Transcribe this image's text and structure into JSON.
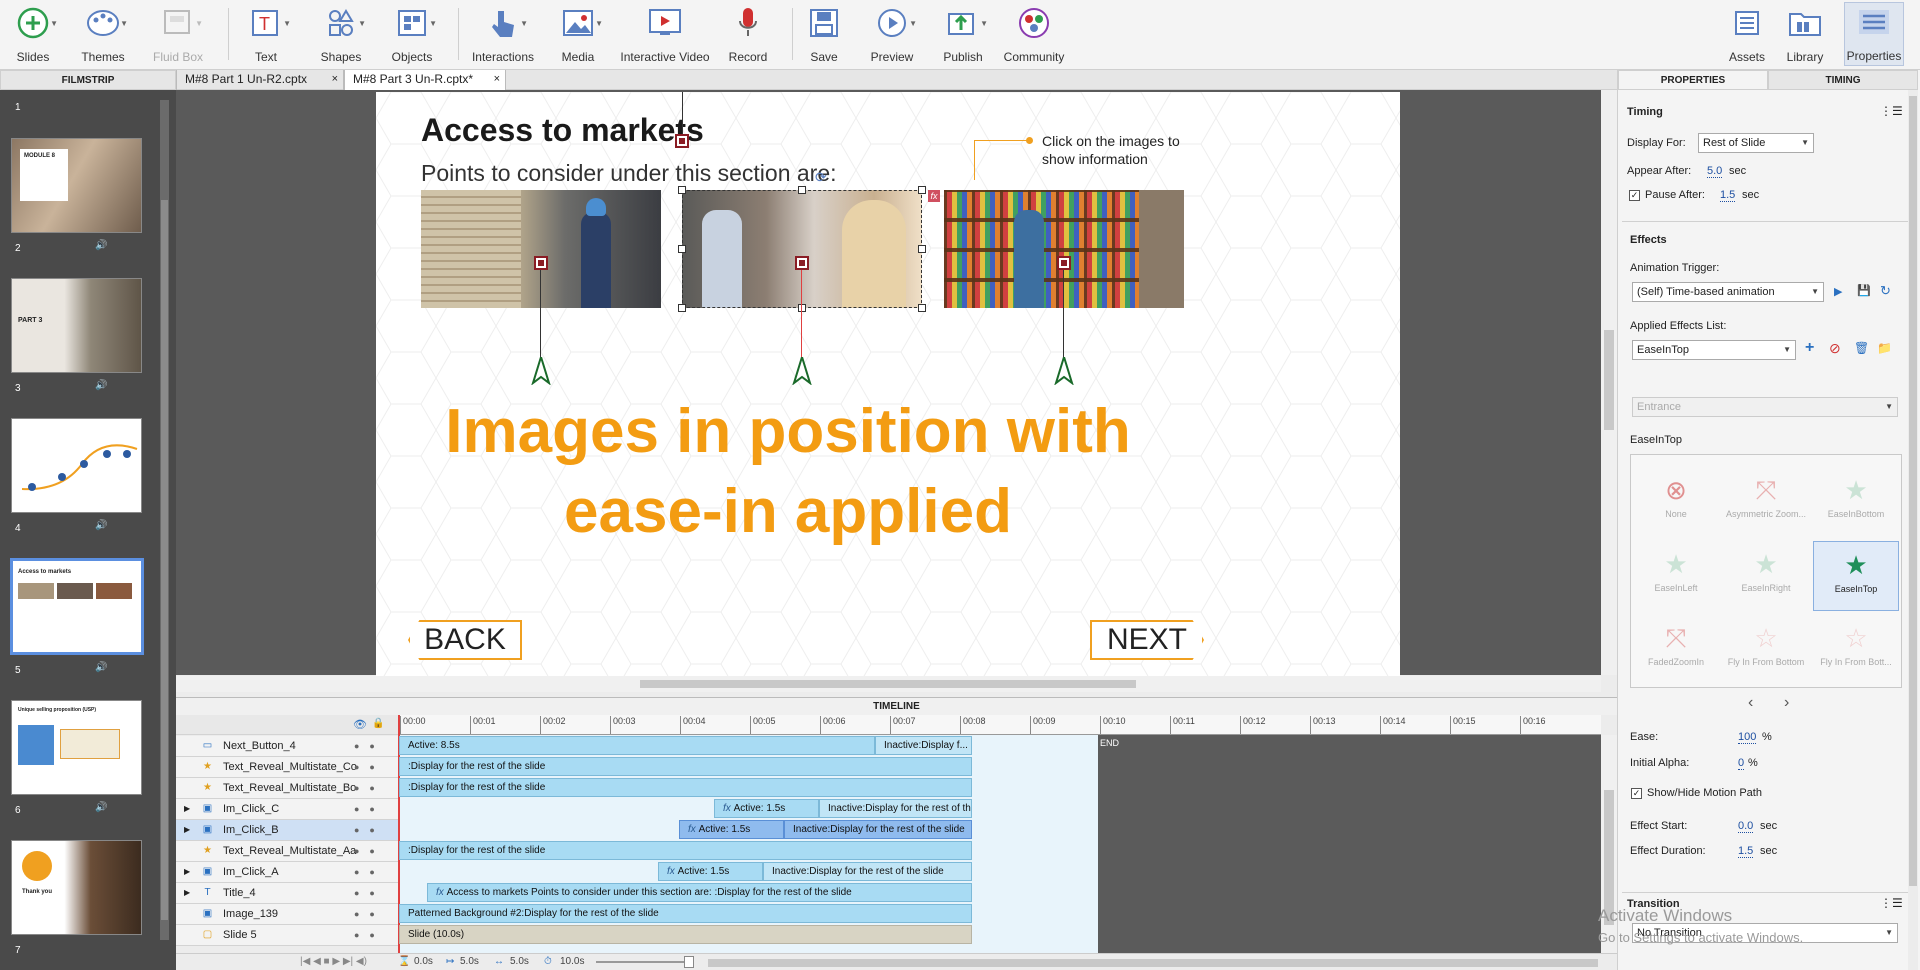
{
  "toolbar": {
    "items": [
      {
        "label": "Slides",
        "icon": "plus-circle-icon"
      },
      {
        "label": "Themes",
        "icon": "palette-icon"
      },
      {
        "label": "Fluid Box",
        "icon": "fluid-box-icon"
      },
      {
        "label": "Text",
        "icon": "text-box-icon"
      },
      {
        "label": "Shapes",
        "icon": "shapes-icon"
      },
      {
        "label": "Objects",
        "icon": "objects-icon"
      },
      {
        "label": "Interactions",
        "icon": "hand-pointer-icon"
      },
      {
        "label": "Media",
        "icon": "image-icon"
      },
      {
        "label": "Interactive Video",
        "icon": "video-icon"
      },
      {
        "label": "Record",
        "icon": "microphone-icon"
      },
      {
        "label": "Save",
        "icon": "save-icon"
      },
      {
        "label": "Preview",
        "icon": "play-circle-icon"
      },
      {
        "label": "Publish",
        "icon": "publish-icon"
      },
      {
        "label": "Community",
        "icon": "community-icon"
      },
      {
        "label": "Assets",
        "icon": "assets-icon"
      },
      {
        "label": "Library",
        "icon": "folder-icon"
      },
      {
        "label": "Properties",
        "icon": "properties-icon"
      }
    ]
  },
  "filmstrip": {
    "header": "FILMSTRIP",
    "slides": [
      "1",
      "2",
      "3",
      "4",
      "5",
      "6",
      "7"
    ],
    "thumb_texts": {
      "s2": "MODULE 8",
      "s3": "PART 3",
      "s5": "Access to markets",
      "s6": "Unique selling proposition (USP)",
      "s7": "Thank you"
    }
  },
  "tabs": [
    {
      "label": "M#8 Part 1 Un-R2.cptx",
      "close": "×"
    },
    {
      "label": "M#8 Part 3 Un-R.cptx*",
      "close": "×"
    }
  ],
  "slide": {
    "title": "Access to markets",
    "subtitle": "Points to consider under this section are:",
    "callout": "Click on the images to show information",
    "headline_line1": "Images in position with",
    "headline_line2": "ease-in applied",
    "back_label": "BACK",
    "next_label": "NEXT",
    "fx_badge": "fx",
    "accent_color": "#f39c12"
  },
  "panel": {
    "tabs": [
      "PROPERTIES",
      "TIMING"
    ],
    "timing_header": "Timing",
    "display_for_label": "Display For:",
    "display_for_value": "Rest of Slide",
    "appear_after_label": "Appear After:",
    "appear_after_value": "5.0",
    "pause_after_label": "Pause After:",
    "pause_after_value": "1.5",
    "sec": "sec",
    "effects_header": "Effects",
    "animation_trigger_label": "Animation Trigger:",
    "animation_trigger_value": "(Self) Time-based animation",
    "applied_effects_label": "Applied Effects List:",
    "applied_effect_value": "EaseInTop",
    "category_value": "Entrance",
    "effect_group_label": "EaseInTop",
    "effects": [
      {
        "name": "None",
        "selected": false
      },
      {
        "name": "Asymmetric Zoom...",
        "selected": false
      },
      {
        "name": "EaseInBottom",
        "selected": false
      },
      {
        "name": "EaseInLeft",
        "selected": false
      },
      {
        "name": "EaseInRight",
        "selected": false
      },
      {
        "name": "EaseInTop",
        "selected": true
      },
      {
        "name": "FadedZoomIn",
        "selected": false
      },
      {
        "name": "Fly In From Bottom",
        "selected": false
      },
      {
        "name": "Fly In From Bott...",
        "selected": false
      }
    ],
    "ease_label": "Ease:",
    "ease_value": "100",
    "initial_alpha_label": "Initial Alpha:",
    "initial_alpha_value": "0",
    "percent": "%",
    "show_hide_label": "Show/Hide Motion Path",
    "effect_start_label": "Effect Start:",
    "effect_start_value": "0.0",
    "effect_duration_label": "Effect Duration:",
    "effect_duration_value": "1.5",
    "transition_header": "Transition",
    "transition_value": "No Transition",
    "watermark_title": "Activate Windows",
    "watermark_sub": "Go to Settings to activate Windows."
  },
  "timeline": {
    "header": "TIMELINE",
    "ticks": [
      "00:00",
      "00:01",
      "00:02",
      "00:03",
      "00:04",
      "00:05",
      "00:06",
      "00:07",
      "00:08",
      "00:09",
      "00:10",
      "00:11",
      "00:12",
      "00:13",
      "00:14",
      "00:15",
      "00:16"
    ],
    "end_label": "END",
    "rows": [
      {
        "name": "Next_Button_4",
        "icon": "button-icon",
        "expand": false
      },
      {
        "name": "Text_Reveal_Multistate_Co",
        "icon": "star-icon",
        "expand": false
      },
      {
        "name": "Text_Reveal_Multistate_Bo",
        "icon": "star-icon",
        "expand": false
      },
      {
        "name": "Im_Click_C",
        "icon": "image-icon",
        "expand": true
      },
      {
        "name": "Im_Click_B",
        "icon": "image-icon",
        "expand": true
      },
      {
        "name": "Text_Reveal_Multistate_Aa",
        "icon": "star-icon",
        "expand": false
      },
      {
        "name": "Im_Click_A",
        "icon": "image-icon",
        "expand": true
      },
      {
        "name": "Title_4",
        "icon": "text-icon",
        "expand": true
      },
      {
        "name": "Image_139",
        "icon": "image-icon",
        "expand": false
      },
      {
        "name": "Slide 5",
        "icon": "slide-icon",
        "expand": false
      }
    ],
    "bars": {
      "next_active": "Active: 8.5s",
      "next_inactive": "Inactive:Display f...",
      "display_rest": ":Display for the rest of the slide",
      "active_15": "Active: 1.5s",
      "inactive_rest": "Inactive:Display for the rest of the slide",
      "title_bar": "Access to markets Points to consider under this section are: :Display for the rest of the slide",
      "image_bar": "Patterned Background #2:Display for the rest of the slide",
      "slide_bar": "Slide (10.0s)"
    },
    "footer": {
      "t0": "0.0s",
      "t1": "5.0s",
      "t2": "5.0s",
      "t3": "10.0s"
    }
  }
}
